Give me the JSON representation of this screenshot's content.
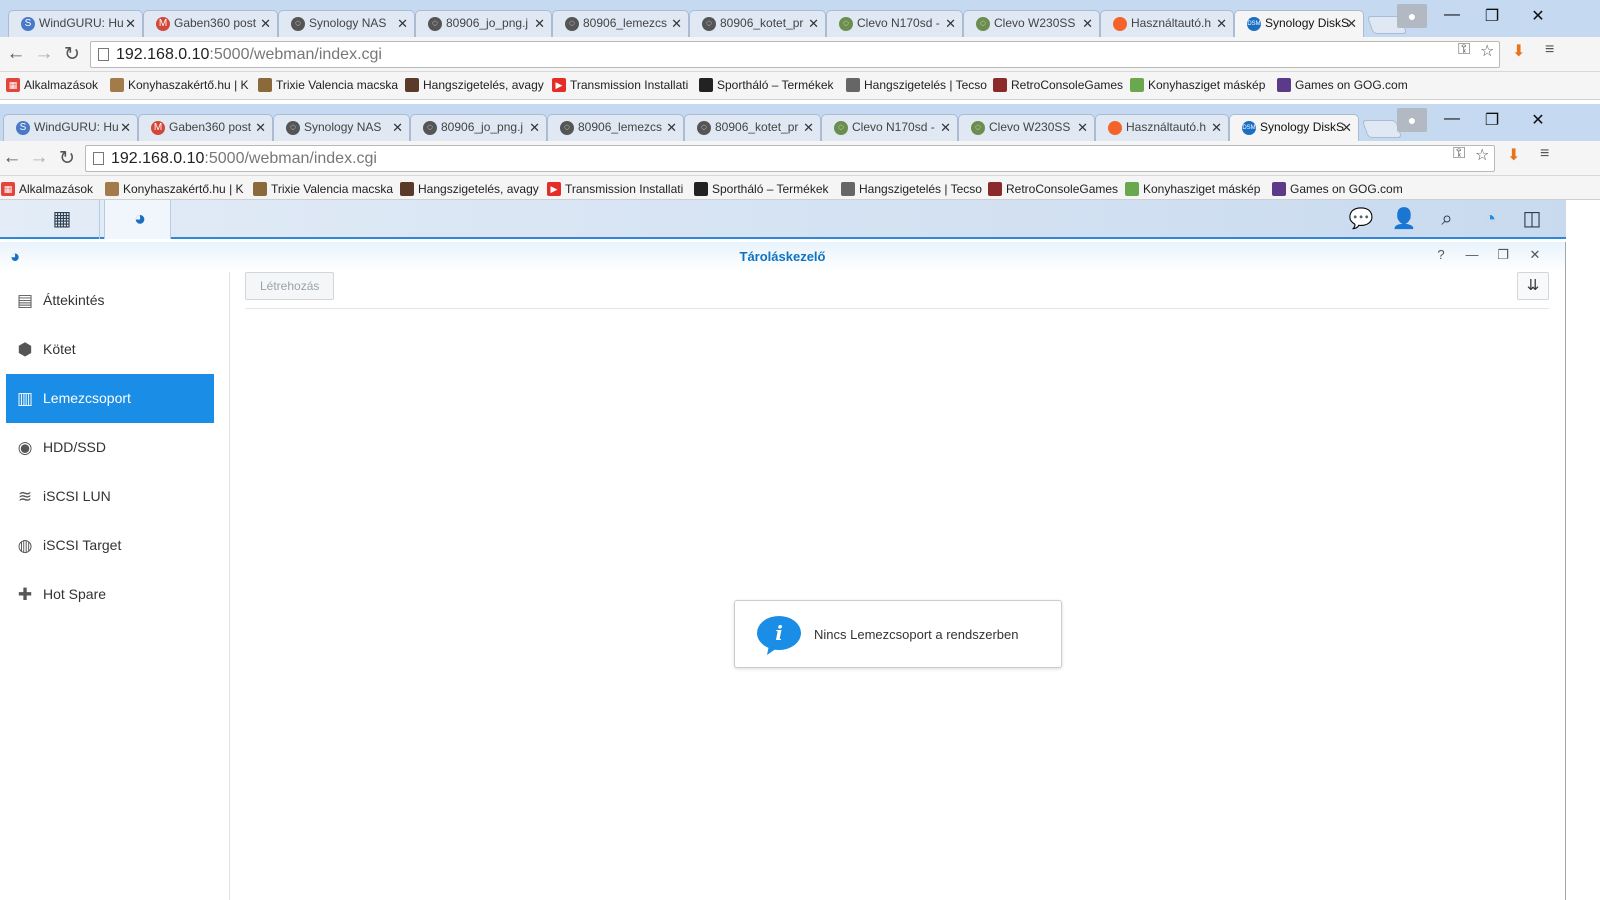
{
  "browser": {
    "tabs": [
      {
        "label": "WindGURU: Hu",
        "color": "#4a79c8",
        "glyph": "S"
      },
      {
        "label": "Gaben360 post",
        "color": "#d44638",
        "glyph": "M"
      },
      {
        "label": "Synology NAS",
        "color": "#555555",
        "glyph": "◌"
      },
      {
        "label": "80906_jo_png.j",
        "color": "#555555",
        "glyph": "◌"
      },
      {
        "label": "80906_lemezcs",
        "color": "#555555",
        "glyph": "◌"
      },
      {
        "label": "80906_kotet_pr",
        "color": "#555555",
        "glyph": "◌"
      },
      {
        "label": "Clevo N170sd -",
        "color": "#6b8e4e",
        "glyph": "◌"
      },
      {
        "label": "Clevo W230SS",
        "color": "#6b8e4e",
        "glyph": "◌"
      },
      {
        "label": "Használtautó.h",
        "color": "#f4642a",
        "glyph": ""
      },
      {
        "label": "Synology DiskS",
        "color": "#1a6fc4",
        "glyph": "DSM",
        "active": true
      }
    ],
    "url_host": "192.168.0.10",
    "url_path": ":5000/webman/index.cgi",
    "bookmarks": [
      {
        "label": "Alkalmazások",
        "color": "#e2453c"
      },
      {
        "label": "Konyhaszakértő.hu | K",
        "color": "#a37a4a"
      },
      {
        "label": "Trixie Valencia macska",
        "color": "#8a6a3a"
      },
      {
        "label": "Hangszigetelés, avagy",
        "color": "#5a3b2a"
      },
      {
        "label": "Transmission Installati",
        "color": "#e52d27"
      },
      {
        "label": "Sportháló – Termékek",
        "color": "#222222"
      },
      {
        "label": "Hangszigetelés | Tecso",
        "color": "#666666"
      },
      {
        "label": "RetroConsoleGames",
        "color": "#8b2a2a"
      },
      {
        "label": "Konyhasziget máskép",
        "color": "#6aa84f"
      },
      {
        "label": "Games on GOG.com",
        "color": "#5b3a8a"
      }
    ]
  },
  "app": {
    "title": "Tároláskezelő",
    "nav": [
      {
        "label": "Áttekintés",
        "icon": "overview-icon",
        "glyph": "▤"
      },
      {
        "label": "Kötet",
        "icon": "volume-icon",
        "glyph": "⬢"
      },
      {
        "label": "Lemezcsoport",
        "icon": "disk-group-icon",
        "glyph": "▥",
        "active": true
      },
      {
        "label": "HDD/SSD",
        "icon": "hdd-icon",
        "glyph": "◉"
      },
      {
        "label": "iSCSI LUN",
        "icon": "iscsi-lun-icon",
        "glyph": "≋"
      },
      {
        "label": "iSCSI Target",
        "icon": "iscsi-target-icon",
        "glyph": "◍"
      },
      {
        "label": "Hot Spare",
        "icon": "hot-spare-icon",
        "glyph": "✚"
      }
    ],
    "create_label": "Létrehozás",
    "empty_message": "Nincs Lemezcsoport a rendszerben"
  },
  "colors": {
    "accent": "#1a8de6",
    "title": "#0e73c3"
  }
}
